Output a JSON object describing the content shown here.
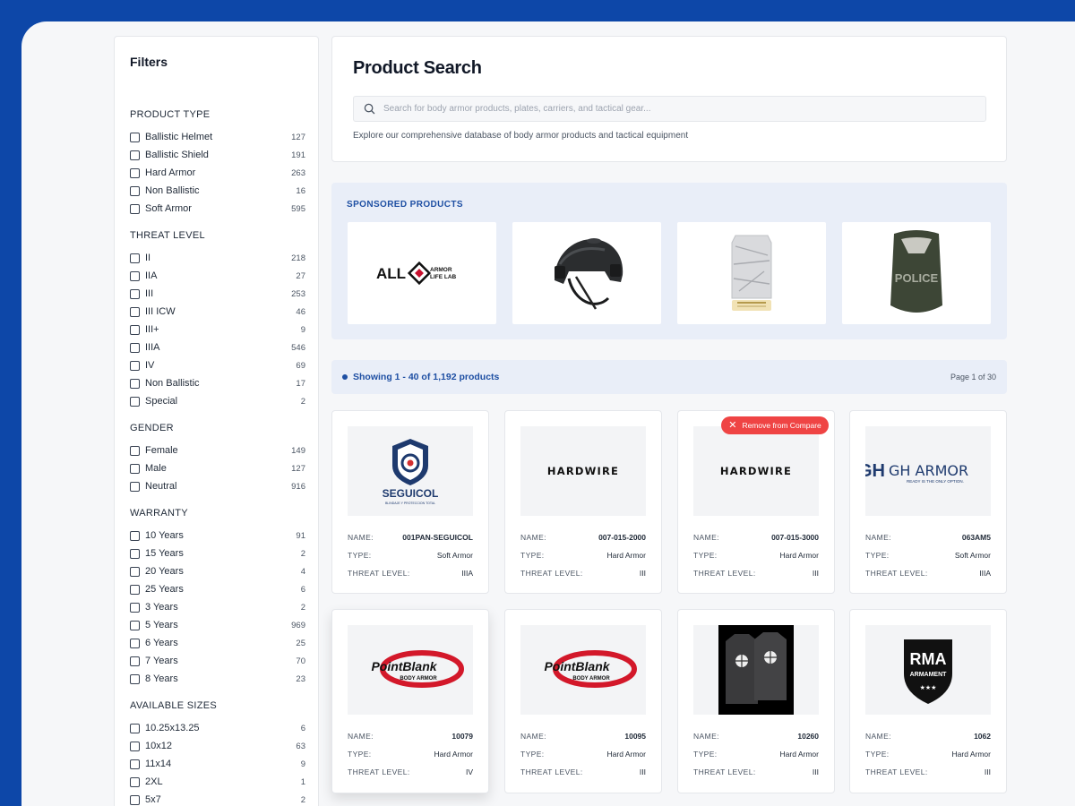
{
  "filters": {
    "title": "Filters",
    "groups": [
      {
        "title": "PRODUCT TYPE",
        "items": [
          {
            "label": "Ballistic Helmet",
            "count": "127"
          },
          {
            "label": "Ballistic Shield",
            "count": "191"
          },
          {
            "label": "Hard Armor",
            "count": "263"
          },
          {
            "label": "Non Ballistic",
            "count": "16"
          },
          {
            "label": "Soft Armor",
            "count": "595"
          }
        ]
      },
      {
        "title": "THREAT LEVEL",
        "items": [
          {
            "label": "II",
            "count": "218"
          },
          {
            "label": "IIA",
            "count": "27"
          },
          {
            "label": "III",
            "count": "253"
          },
          {
            "label": "III ICW",
            "count": "46"
          },
          {
            "label": "III+",
            "count": "9"
          },
          {
            "label": "IIIA",
            "count": "546"
          },
          {
            "label": "IV",
            "count": "69"
          },
          {
            "label": "Non Ballistic",
            "count": "17"
          },
          {
            "label": "Special",
            "count": "2"
          }
        ]
      },
      {
        "title": "GENDER",
        "items": [
          {
            "label": "Female",
            "count": "149"
          },
          {
            "label": "Male",
            "count": "127"
          },
          {
            "label": "Neutral",
            "count": "916"
          }
        ]
      },
      {
        "title": "WARRANTY",
        "items": [
          {
            "label": "10 Years",
            "count": "91"
          },
          {
            "label": "15 Years",
            "count": "2"
          },
          {
            "label": "20 Years",
            "count": "4"
          },
          {
            "label": "25 Years",
            "count": "6"
          },
          {
            "label": "3 Years",
            "count": "2"
          },
          {
            "label": "5 Years",
            "count": "969"
          },
          {
            "label": "6 Years",
            "count": "25"
          },
          {
            "label": "7 Years",
            "count": "70"
          },
          {
            "label": "8 Years",
            "count": "23"
          }
        ]
      },
      {
        "title": "AVAILABLE SIZES",
        "items": [
          {
            "label": "10.25x13.25",
            "count": "6"
          },
          {
            "label": "10x12",
            "count": "63"
          },
          {
            "label": "11x14",
            "count": "9"
          },
          {
            "label": "2XL",
            "count": "1"
          },
          {
            "label": "5x7",
            "count": "2"
          }
        ]
      }
    ]
  },
  "search": {
    "title": "Product Search",
    "placeholder": "Search for body armor products, plates, carriers, and tactical gear...",
    "description": "Explore our comprehensive database of body armor products and tactical equipment"
  },
  "sponsored": {
    "title": "SPONSORED PRODUCTS",
    "items": [
      {
        "logo_main": "ALL",
        "logo_sub1": "ARMOR",
        "logo_sub2": "LIFE LAB",
        "kind": "armor-life-lab-logo"
      },
      {
        "kind": "helmet-image"
      },
      {
        "kind": "plate-image"
      },
      {
        "logo_text": "POLICE",
        "kind": "police-shield-image"
      }
    ]
  },
  "results": {
    "showing": "Showing 1 - 40 of 1,192 products",
    "page": "Page 1 of 30"
  },
  "compare": {
    "remove_label": "Remove from Compare"
  },
  "labels": {
    "name": "NAME:",
    "type": "TYPE:",
    "threat": "THREAT LEVEL:"
  },
  "products": [
    {
      "name": "001PAN-SEGUICOL",
      "type": "Soft Armor",
      "threat": "IIIA",
      "brand": "SEGUICOL",
      "brand_tag": "BLINDAJE Y PROTECCION TOTAL"
    },
    {
      "name": "007-015-2000",
      "type": "Hard Armor",
      "threat": "III",
      "brand": "HARDWIRE"
    },
    {
      "name": "007-015-3000",
      "type": "Hard Armor",
      "threat": "III",
      "brand": "HARDWIRE"
    },
    {
      "name": "063AM5",
      "type": "Soft Armor",
      "threat": "IIIA",
      "brand": "GH ARMOR",
      "brand_tag": "READY IS THE ONLY OPTION."
    },
    {
      "name": "10079",
      "type": "Hard Armor",
      "threat": "IV",
      "brand": "PointBlank",
      "brand_tag": "BODY ARMOR"
    },
    {
      "name": "10095",
      "type": "Hard Armor",
      "threat": "III",
      "brand": "PointBlank",
      "brand_tag": "BODY ARMOR"
    },
    {
      "name": "10260",
      "type": "Hard Armor",
      "threat": "III"
    },
    {
      "name": "1062",
      "type": "Hard Armor",
      "threat": "III",
      "brand": "RMA",
      "brand_tag": "ARMAMENT"
    }
  ],
  "colors": {
    "brand_blue": "#0d47a8",
    "accent_blue": "#1e4fa3",
    "remove_red": "#ef4444"
  }
}
